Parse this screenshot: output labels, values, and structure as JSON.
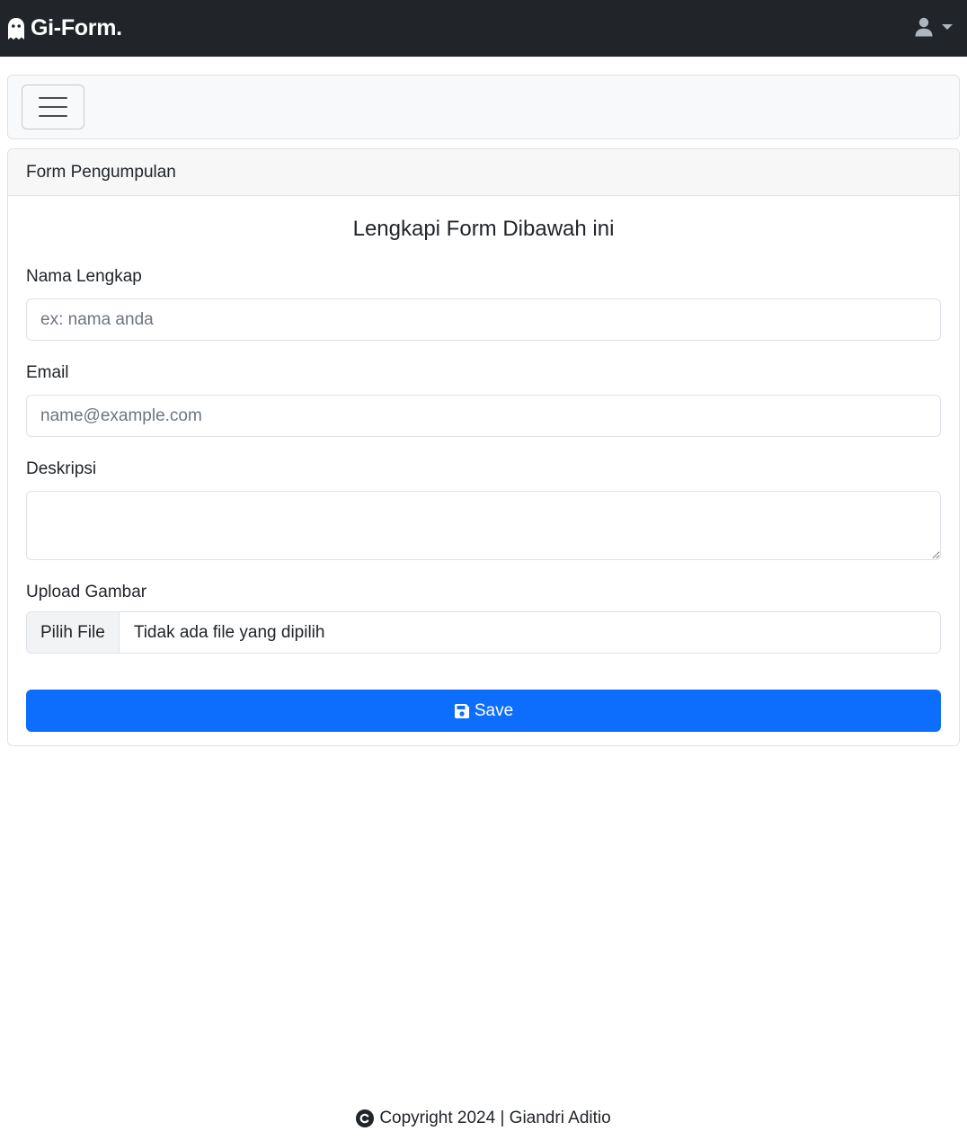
{
  "navbar": {
    "brand": "Gi-Form.",
    "brand_icon": "ghost-icon",
    "user_icon": "user-icon",
    "menu_caret": "caret-down-icon"
  },
  "toolbar": {
    "toggler_icon": "hamburger-icon"
  },
  "card": {
    "header": "Form Pengumpulan",
    "title": "Lengkapi Form Dibawah ini",
    "fields": {
      "name": {
        "label": "Nama Lengkap",
        "placeholder": "ex: nama anda"
      },
      "email": {
        "label": "Email",
        "placeholder": "name@example.com"
      },
      "description": {
        "label": "Deskripsi"
      },
      "upload": {
        "label": "Upload Gambar",
        "button": "Pilih File",
        "status": "Tidak ada file yang dipilih"
      }
    },
    "save_button": {
      "label": "Save",
      "icon": "floppy-disk-icon",
      "color": "#0d6efd"
    }
  },
  "footer": {
    "icon": "copyright-icon",
    "text": "Copyright 2024 | Giandri Aditio"
  }
}
